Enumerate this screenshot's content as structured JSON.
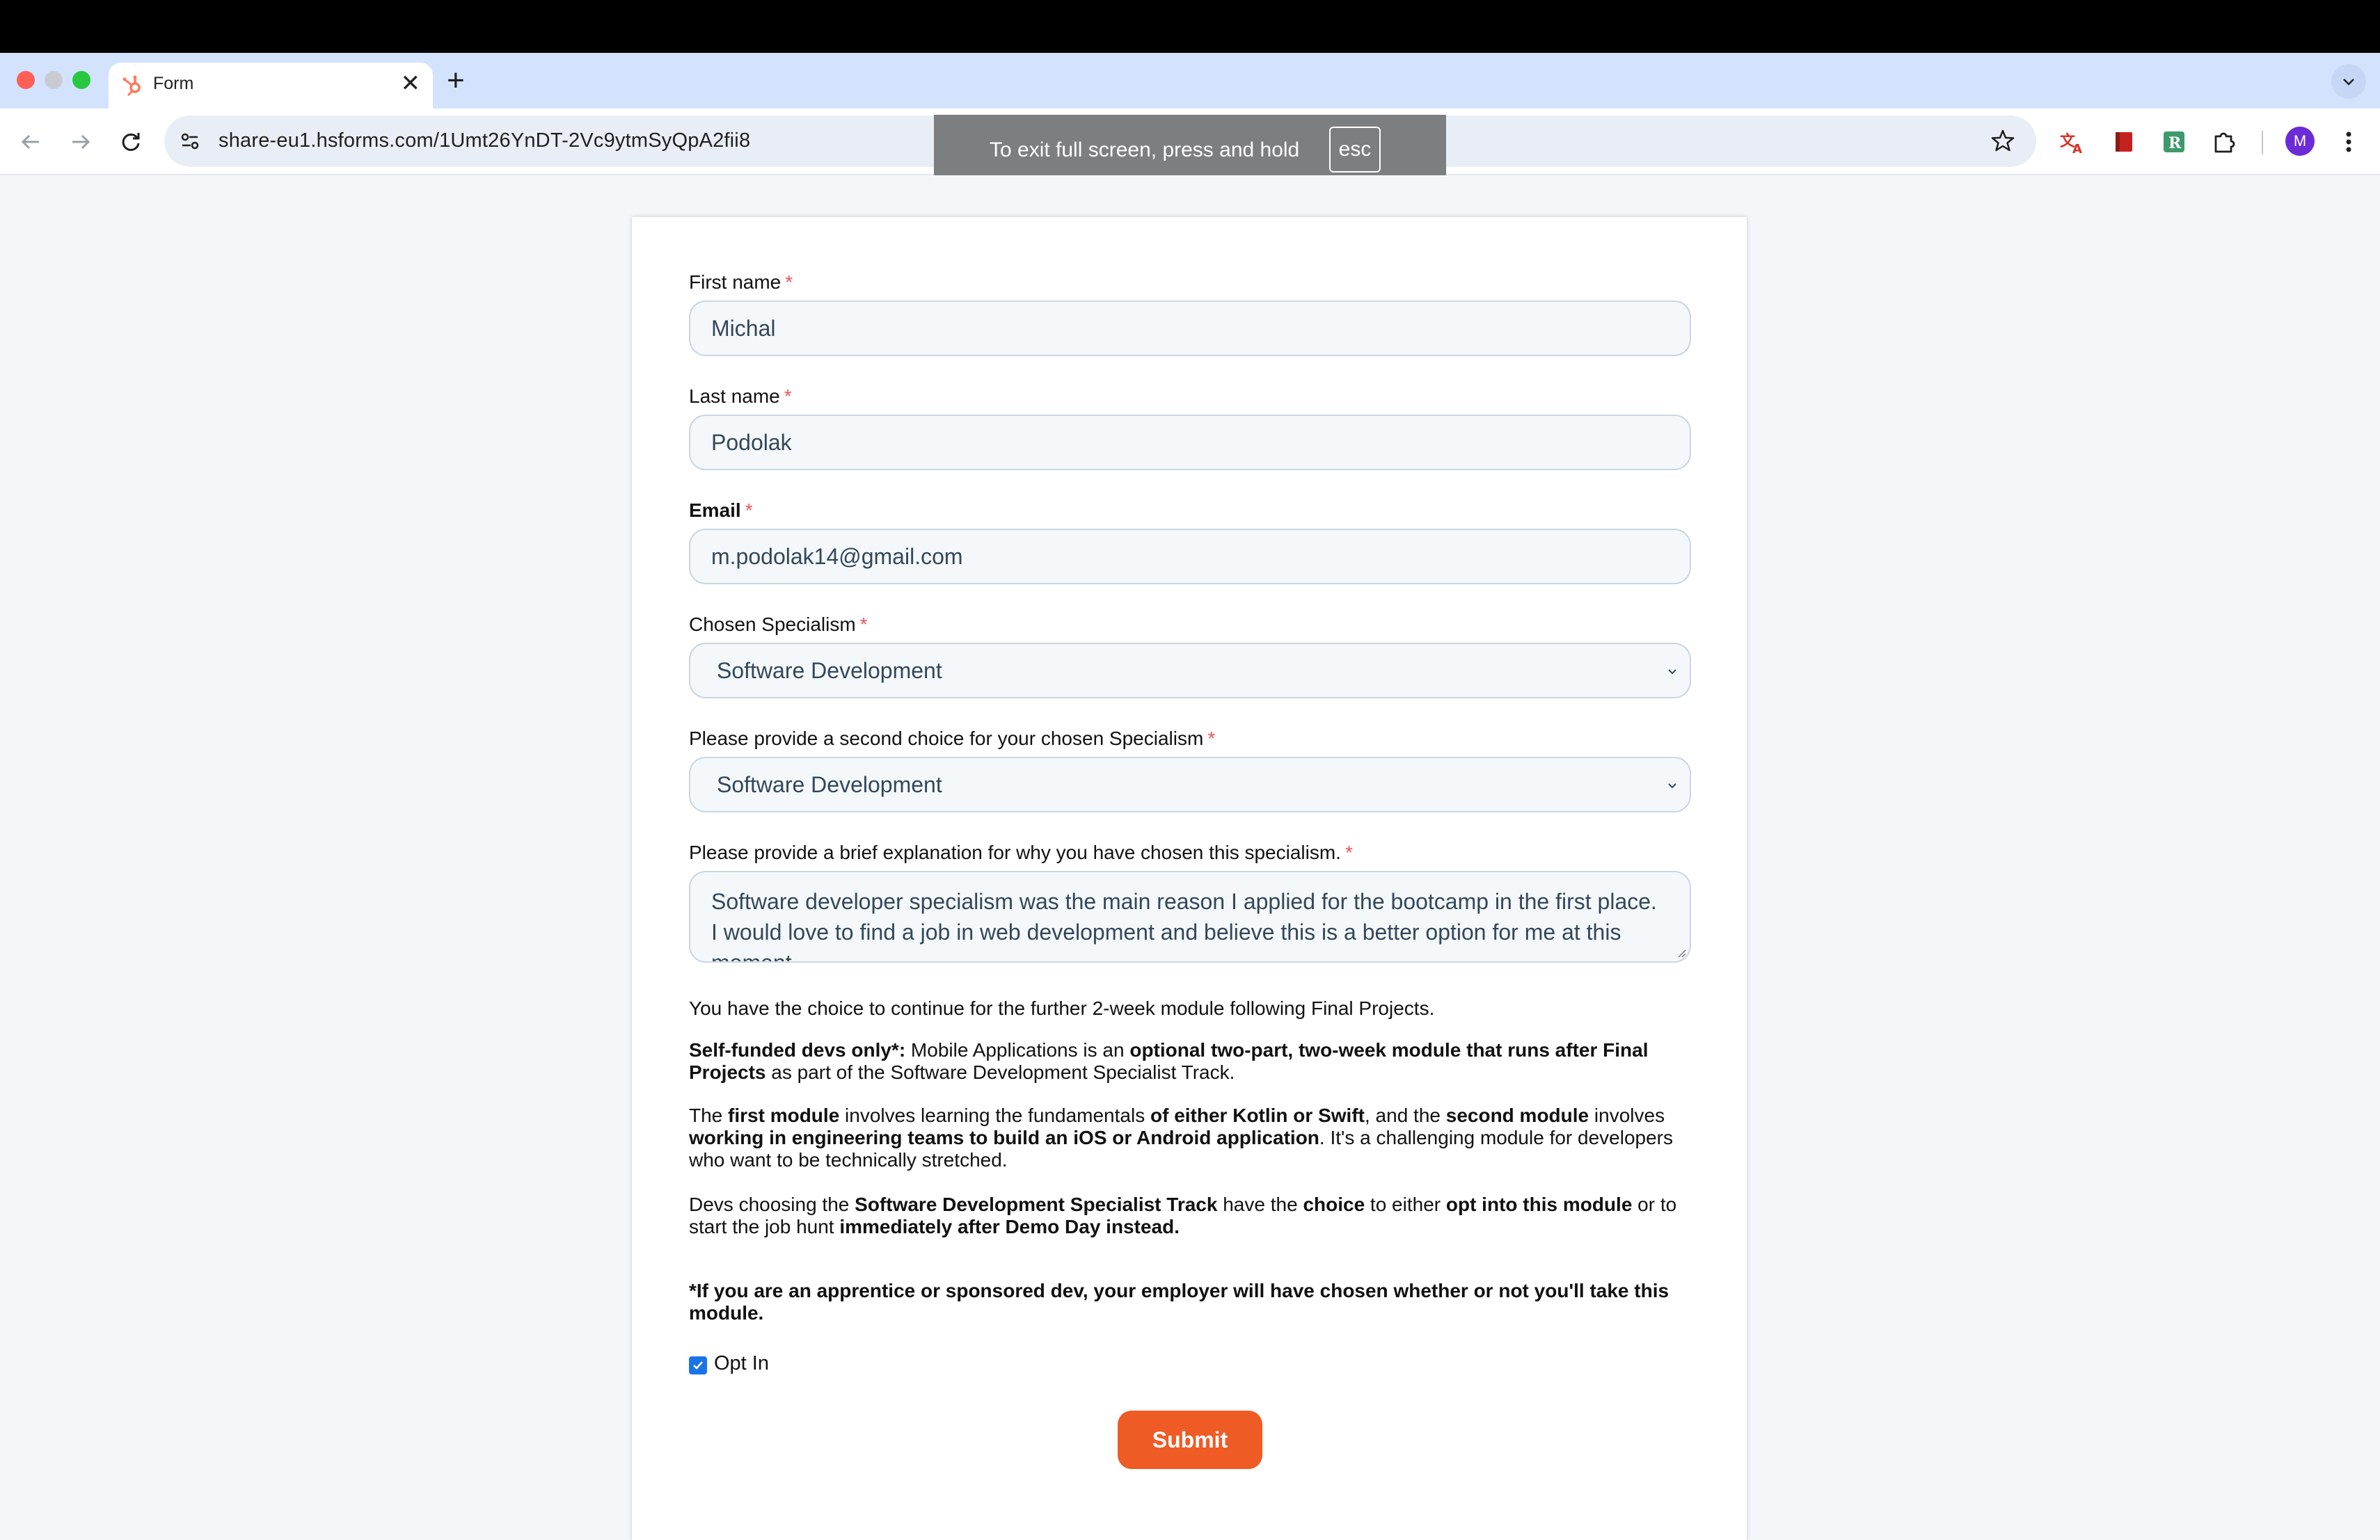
{
  "browser": {
    "tab_title": "Form",
    "new_tab_label": "+",
    "close_tab_label": "✕",
    "url": "share-eu1.hsforms.com/1Umt26YnDT-2Vc9ytmSyQpA2fii8",
    "avatar_initial": "M",
    "fullscreen_toast": {
      "text": "To exit full screen, press and hold",
      "key": "esc"
    }
  },
  "form": {
    "first_name": {
      "label": "First name",
      "required": "*",
      "value": "Michal"
    },
    "last_name": {
      "label": "Last name",
      "required": "*",
      "value": "Podolak"
    },
    "email": {
      "label": "Email",
      "required": "*",
      "value": "m.podolak14@gmail.com"
    },
    "specialism": {
      "label": "Chosen Specialism",
      "required": "*",
      "value": "Software Development"
    },
    "second_choice": {
      "label": "Please provide a second choice for your chosen Specialism",
      "required": "*",
      "value": "Software Development"
    },
    "explanation": {
      "label": "Please provide a brief explanation for why you have chosen this specialism.",
      "required": "*",
      "value": "Software developer specialism was the main reason I applied for the bootcamp in the first place. I would love to find a job in web development and believe this is a better option for me at this moment."
    },
    "intro": "You have the choice to continue for the further 2-week module following Final Projects.",
    "p1": {
      "a": "Self-funded devs only*:",
      "b": " Mobile Applications is an ",
      "c": "optional two-part, two-week module that runs after Final Projects",
      "d": " as part of the Software Development Specialist Track."
    },
    "p2": {
      "a": "The ",
      "b": "first module",
      "c": " involves learning the fundamentals ",
      "d": "of either Kotlin or Swift",
      "e": ", and the ",
      "f": "second module",
      "g": " involves ",
      "h": "working in engineering teams to build an iOS or Android application",
      "i": ". It's a challenging module for developers who want to be technically stretched."
    },
    "p3": {
      "a": "Devs choosing the ",
      "b": "Software Development Specialist Track",
      "c": " have the ",
      "d": "choice",
      "e": " to either ",
      "f": "opt into this module",
      "g": " or to start the job hunt ",
      "h": "immediately after Demo Day instead."
    },
    "note": "*If you are an apprentice or sponsored dev, your employer will have chosen whether or not you'll take this module.",
    "opt_in": {
      "label": "Opt In",
      "checked": true
    },
    "submit_label": "Submit"
  },
  "colors": {
    "accent": "#ef5b25",
    "required": "#f2545b",
    "checkbox": "#1a73e8"
  }
}
